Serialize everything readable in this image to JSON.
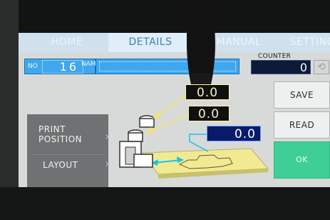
{
  "tabs": [
    {
      "label": "HOME",
      "active": false
    },
    {
      "label": "DETAILS",
      "active": true
    },
    {
      "label": "MANUAL",
      "active": false
    },
    {
      "label": "SETTINGS",
      "active": false
    }
  ],
  "program": {
    "no_label": "NO",
    "no_value": "16",
    "name_label": "NAME",
    "name_value": ""
  },
  "counter": {
    "label": "COUNTER",
    "value": "0",
    "reset_icon": "reset-circle-icon"
  },
  "nav": {
    "print_position": "PRINT\nPOSITION",
    "layout": "LAYOUT"
  },
  "actions": {
    "save": "SAVE",
    "read": "READ",
    "ok": "OK"
  },
  "position_values": {
    "z": "0.0",
    "y": "0.0",
    "x": "0.0"
  },
  "colors": {
    "accent_blue": "#3fa7ee",
    "ok_green": "#3fcf96",
    "arrow_yellow": "#f2e27a",
    "arrow_cyan": "#18c4e8",
    "platform_yellow": "#f1ea93"
  }
}
